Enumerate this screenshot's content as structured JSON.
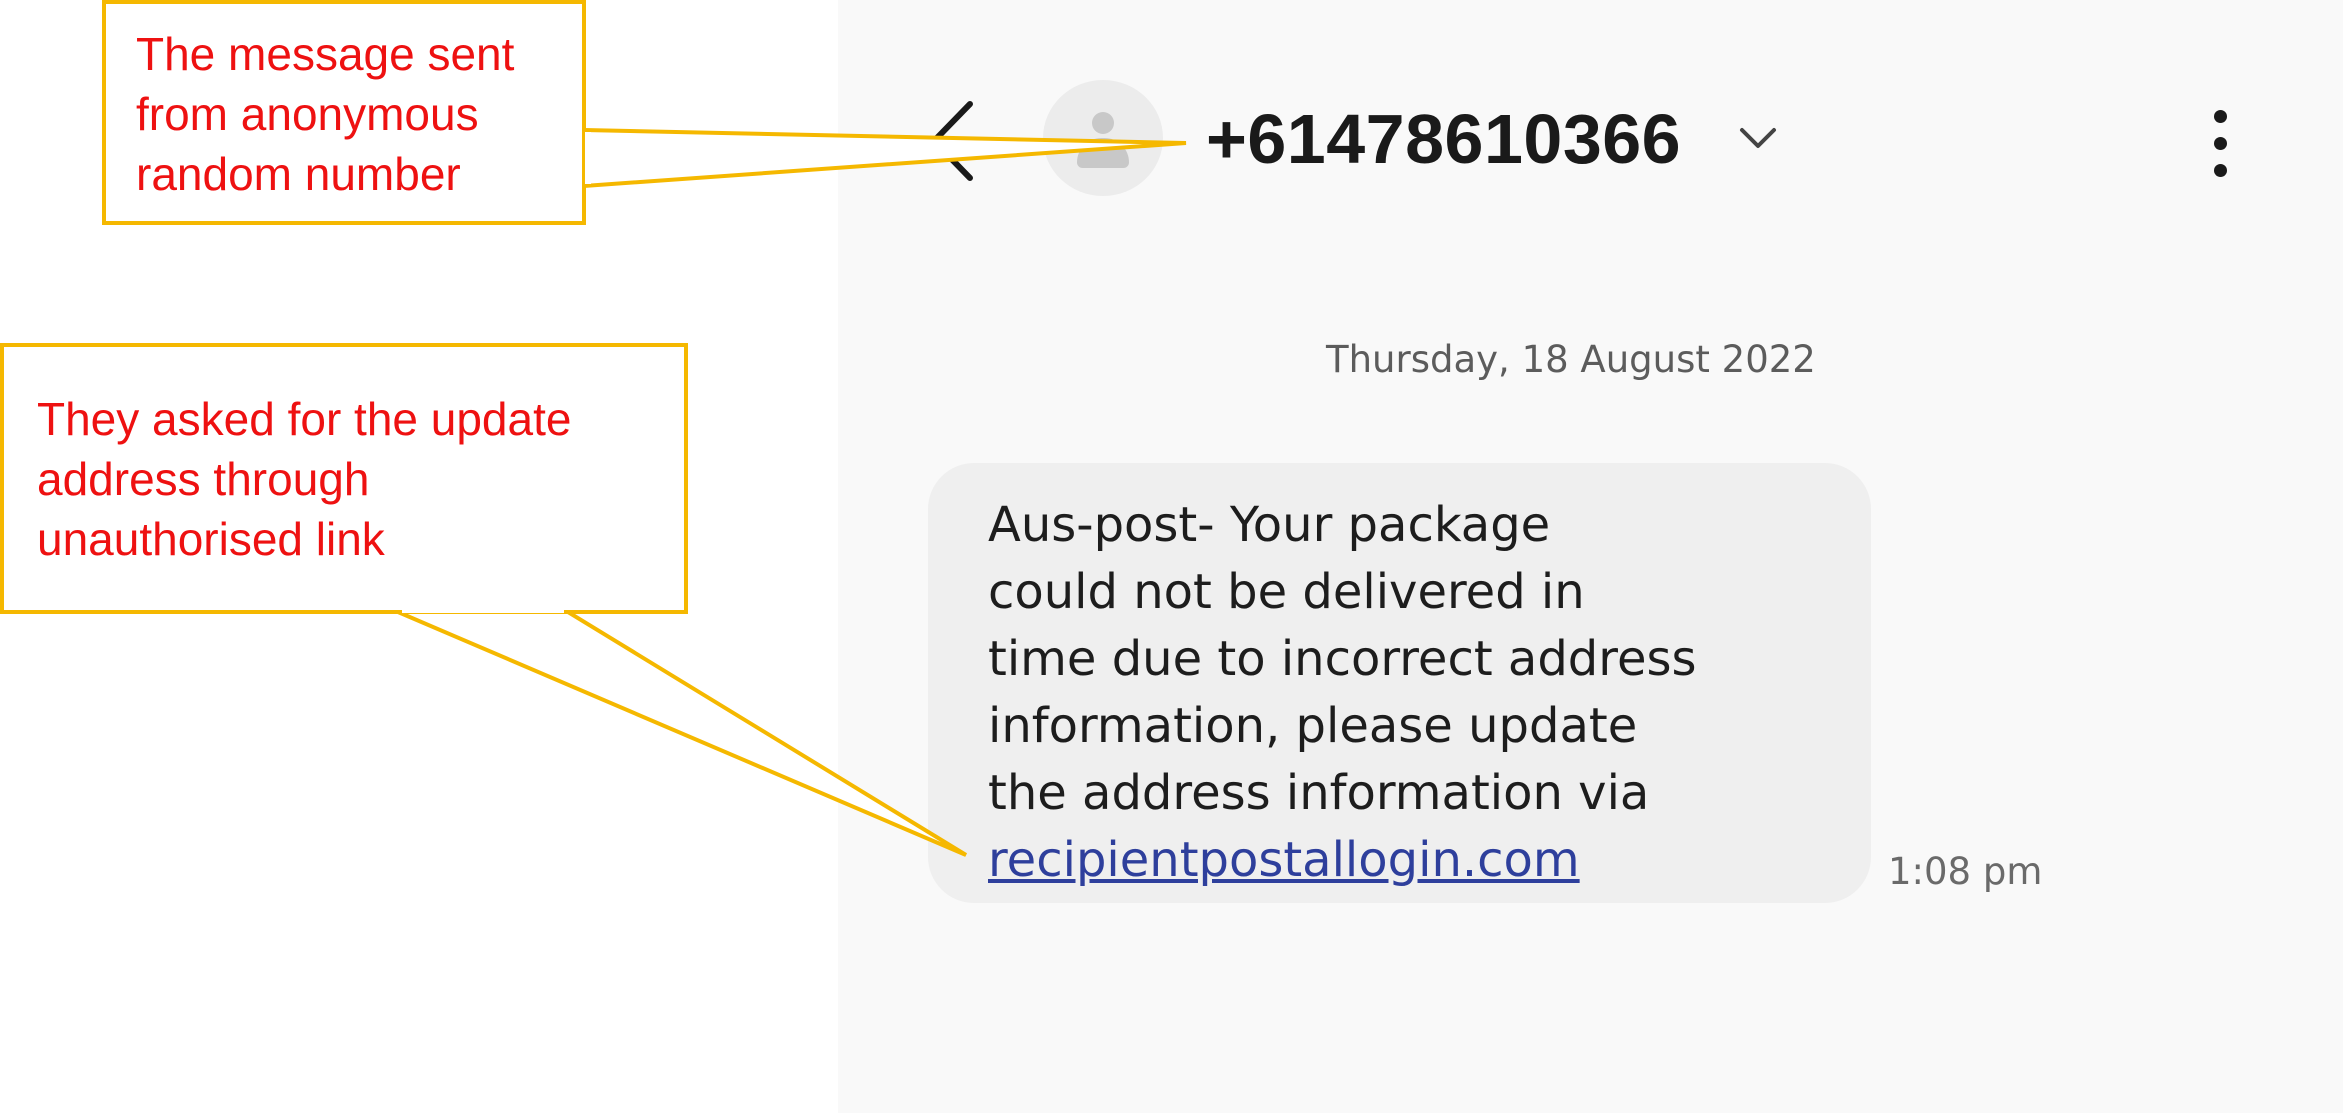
{
  "header": {
    "contact_number": "+61478610366",
    "icons": {
      "back": "back-arrow-icon",
      "avatar": "contact-avatar-icon",
      "chevron": "chevron-down-icon",
      "more": "more-options-icon"
    }
  },
  "conversation": {
    "date": "Thursday, 18 August 2022",
    "message": {
      "lines": [
        "Aus-post- Your package",
        "could not be delivered in",
        "time due to incorrect address",
        "information, please update",
        "the address information via"
      ],
      "link": "recipientpostallogin.com",
      "time": "1:08 pm"
    }
  },
  "annotations": [
    {
      "lines": [
        "The message sent",
        "from anonymous",
        "random number"
      ]
    },
    {
      "lines": [
        "They asked for the update",
        "address through",
        "unauthorised link"
      ]
    }
  ],
  "colors": {
    "callout_border": "#f5b800",
    "callout_text": "#ee1111",
    "link": "#2e3f9c",
    "bubble": "#efefef",
    "panel": "#f9f9f9"
  }
}
